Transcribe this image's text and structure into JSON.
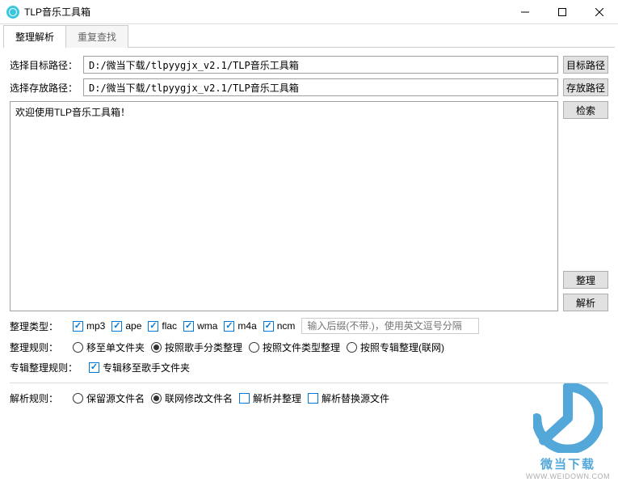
{
  "window": {
    "title": "TLP音乐工具箱"
  },
  "tabs": {
    "t0": "整理解析",
    "t1": "重复查找"
  },
  "paths": {
    "target_label": "选择目标路径：",
    "target_value": "D:/微当下载/tlpyygjx_v2.1/TLP音乐工具箱",
    "save_label": "选择存放路径：",
    "save_value": "D:/微当下载/tlpyygjx_v2.1/TLP音乐工具箱"
  },
  "buttons": {
    "target": "目标路径",
    "save": "存放路径",
    "search": "检索",
    "organize": "整理",
    "parse": "解析"
  },
  "log": {
    "welcome": "欢迎使用TLP音乐工具箱！"
  },
  "type_section": {
    "label": "整理类型：",
    "mp3": "mp3",
    "ape": "ape",
    "flac": "flac",
    "wma": "wma",
    "m4a": "m4a",
    "ncm": "ncm",
    "suffix_placeholder": "输入后缀(不带.)，使用英文逗号分隔"
  },
  "org_rule": {
    "label": "整理规则：",
    "r0": "移至单文件夹",
    "r1": "按照歌手分类整理",
    "r2": "按照文件类型整理",
    "r3": "按照专辑整理(联网)"
  },
  "album_rule": {
    "label": "专辑整理规则：",
    "c0": "专辑移至歌手文件夹"
  },
  "parse_rule": {
    "label": "解析规则：",
    "r0": "保留源文件名",
    "r1": "联网修改文件名",
    "c0": "解析并整理",
    "c1": "解析替换源文件"
  },
  "watermark": {
    "text": "微当下载",
    "url": "WWW.WEIDOWN.COM"
  }
}
